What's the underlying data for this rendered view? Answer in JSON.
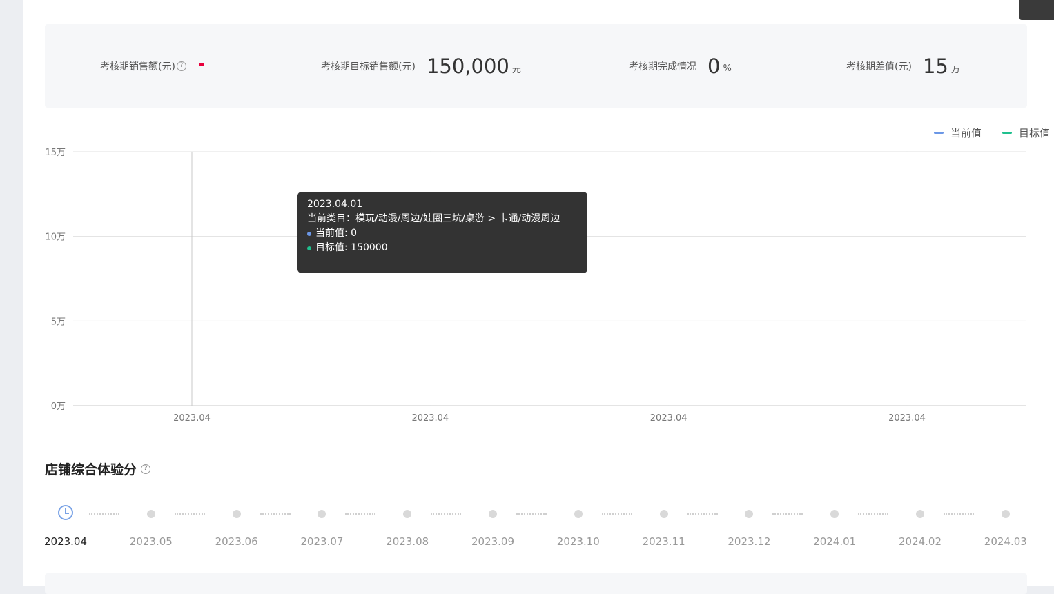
{
  "stats": {
    "sales_label": "考核期销售额(元)",
    "sales_value": "-",
    "target_label": "考核期目标销售额(元)",
    "target_value": "150,000",
    "target_unit": "元",
    "completion_label": "考核期完成情况",
    "completion_value": "0",
    "completion_unit": "%",
    "diff_label": "考核期差值(元)",
    "diff_value": "15",
    "diff_unit": "万"
  },
  "legend": {
    "current": "当前值",
    "target": "目标值"
  },
  "colors": {
    "current": "#6b97e6",
    "target": "#1fc08e",
    "red_dash": "#e8003c"
  },
  "chart_data": {
    "type": "line",
    "x": [
      "2023.04",
      "2023.04",
      "2023.04",
      "2023.04"
    ],
    "series": [
      {
        "name": "当前值",
        "values": [
          0,
          0,
          0,
          0
        ]
      },
      {
        "name": "目标值",
        "values": [
          150000,
          150000,
          150000,
          150000
        ]
      }
    ],
    "y_ticks": [
      "0万",
      "5万",
      "10万",
      "15万"
    ],
    "ylim": [
      0,
      150000
    ],
    "grid": true,
    "legend_position": "top-right"
  },
  "tooltip": {
    "date": "2023.04.01",
    "category_line": "当前类目：模玩/动漫/周边/娃圈三坑/桌游 > 卡通/动漫周边",
    "current_line": "当前值: 0",
    "target_line": "目标值: 150000"
  },
  "experience": {
    "title": "店铺综合体验分",
    "help_icon": "question-circle-icon",
    "months": [
      "2023.04",
      "2023.05",
      "2023.06",
      "2023.07",
      "2023.08",
      "2023.09",
      "2023.10",
      "2023.11",
      "2023.12",
      "2024.01",
      "2024.02",
      "2024.03"
    ],
    "active_month": "2023.04",
    "active_icon": "clock-icon"
  }
}
